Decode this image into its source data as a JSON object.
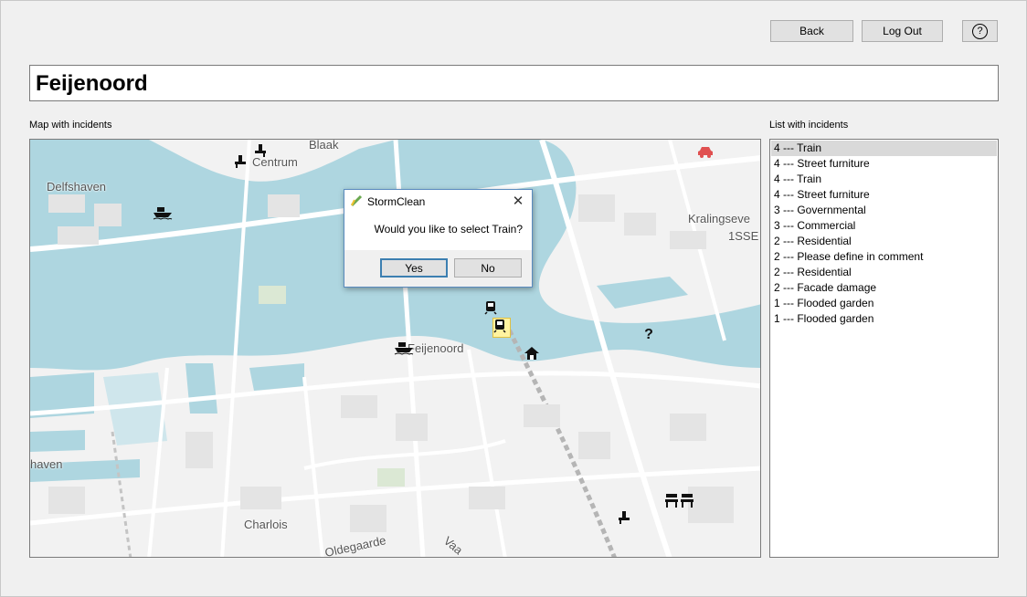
{
  "header": {
    "back_label": "Back",
    "logout_label": "Log Out",
    "help_label": "?"
  },
  "area_title": "Feijenoord",
  "map_section": {
    "label": "Map with incidents",
    "place_labels": [
      "Delfshaven",
      "Centrum",
      "Blaak",
      "Kralingseve",
      "Feijenoord",
      "haven",
      "Charlois",
      "Oldegaarde",
      "Vaa",
      "1SSE"
    ],
    "icons": [
      "train-icon",
      "train-icon",
      "bench-icon",
      "bench-icon",
      "house-icon",
      "boat-icon",
      "boat-icon",
      "car-icon",
      "question-icon",
      "bench-icon"
    ]
  },
  "list_section": {
    "label": "List with incidents",
    "items": [
      "4 --- Train",
      "4 --- Street furniture",
      "4 --- Train",
      "4 --- Street furniture",
      "3 --- Governmental",
      "3 --- Commercial",
      "2 --- Residential",
      "2 --- Please define in comment",
      "2 --- Residential",
      "2 --- Facade damage",
      "1 --- Flooded garden",
      "1 --- Flooded garden"
    ]
  },
  "dialog": {
    "title": "StormClean",
    "message": "Would you like to select Train?",
    "yes_label": "Yes",
    "no_label": "No"
  },
  "colors": {
    "water": "#aed6e0",
    "land": "#f2f2f2",
    "road": "#ffffff",
    "selection": "#d9d9d9",
    "highlight_icon": "#fff3a0",
    "car_icon": "#e05050"
  }
}
